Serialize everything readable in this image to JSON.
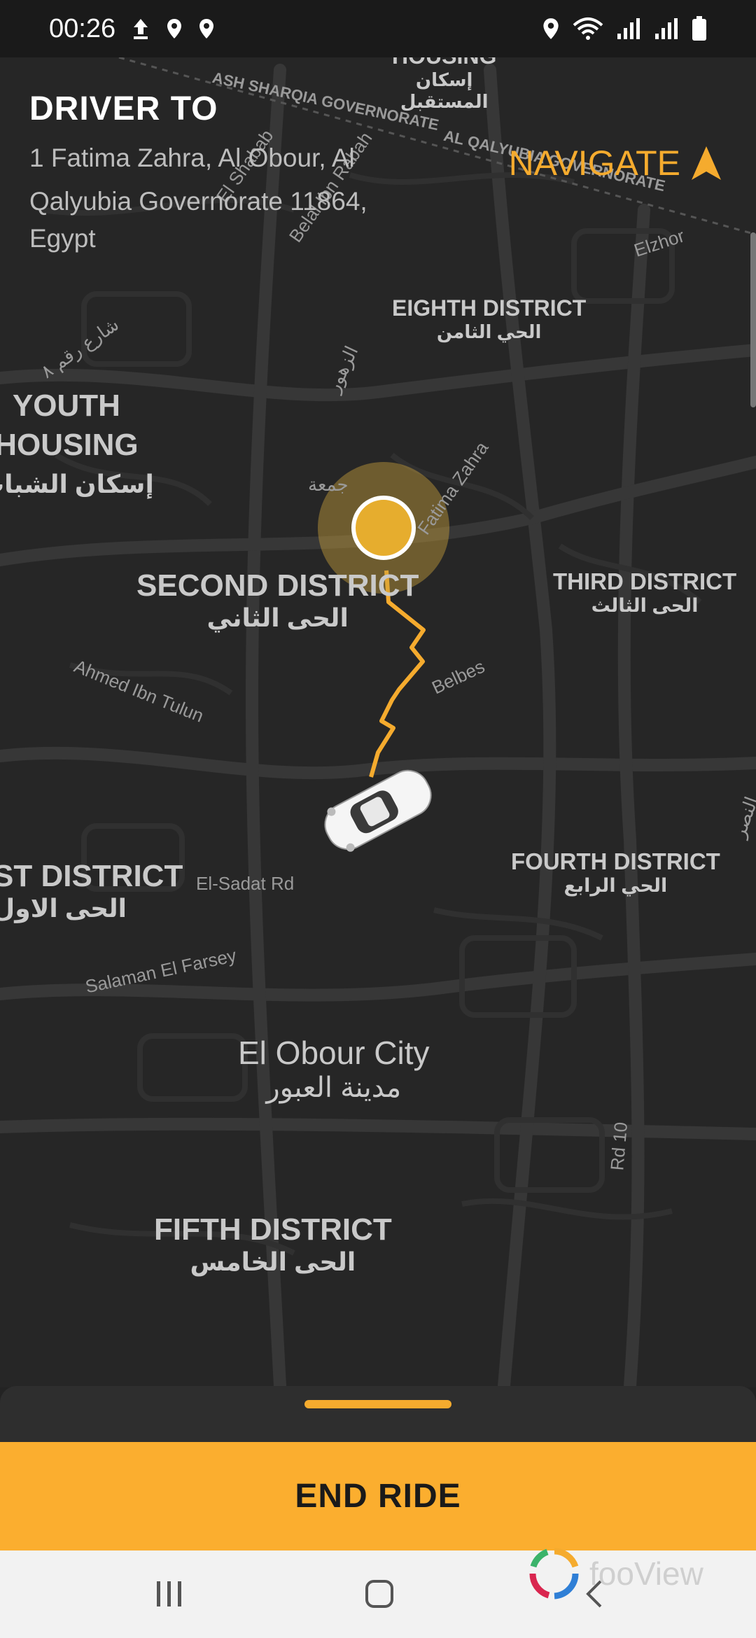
{
  "status_bar": {
    "time": "00:26"
  },
  "header": {
    "title": "DRIVER TO",
    "address_line1": "1 Fatima Zahra, Al Obour, Al",
    "address_line2": "Qalyubia Governorate 11864,",
    "address_line3": "Egypt",
    "navigate": "NAVIGATE"
  },
  "map": {
    "districts": {
      "housing_top": "HOUSING",
      "housing_top_ar1": "إسكان",
      "housing_top_ar2": "المستقبل",
      "eighth": "EIGHTH DISTRICT",
      "eighth_ar": "الحي الثامن",
      "youth1": "YOUTH",
      "youth2": "HOUSING",
      "youth_ar": "إسكان الشباب",
      "second": "SECOND DISTRICT",
      "second_ar": "الحى الثاني",
      "third": "THIRD DISTRICT",
      "third_ar": "الحى الثالث",
      "first": "ST DISTRICT",
      "first_ar": "الحى الاول",
      "fourth": "FOURTH DISTRICT",
      "fourth_ar": "الحي الرابع",
      "city": "El Obour City",
      "city_ar": "مدينة العبور",
      "fifth": "FIFTH DISTRICT",
      "fifth_ar": "الحى الخامس"
    },
    "streets": {
      "ash_sharqia": "ASH SHARQIA GOVERNORATE",
      "qalyubia": "AL QALYUBIA GOVERNORATE",
      "el_shabab": "El Shabab",
      "belal": "Belal Ibn Rabah",
      "elzhor": "Elzhor",
      "street_ar": "شارع رقم ٨",
      "zohour_ar": "الزهور",
      "fatima": "Fatima Zahra",
      "gomaa_ar": "جمعة",
      "ahmed": "Ahmed Ibn Tulun",
      "belbes": "Belbes",
      "sadat": "El-Sadat Rd",
      "salaman": "Salaman El Farsey",
      "rd10": "Rd 10",
      "nasr_ar": "النصر"
    }
  },
  "actions": {
    "end_ride": "END RIDE"
  },
  "watermark": "fooView",
  "colors": {
    "accent": "#f5ab2e",
    "button": "#fbae2f",
    "map_bg": "#262626",
    "road": "#3a3a3a"
  }
}
